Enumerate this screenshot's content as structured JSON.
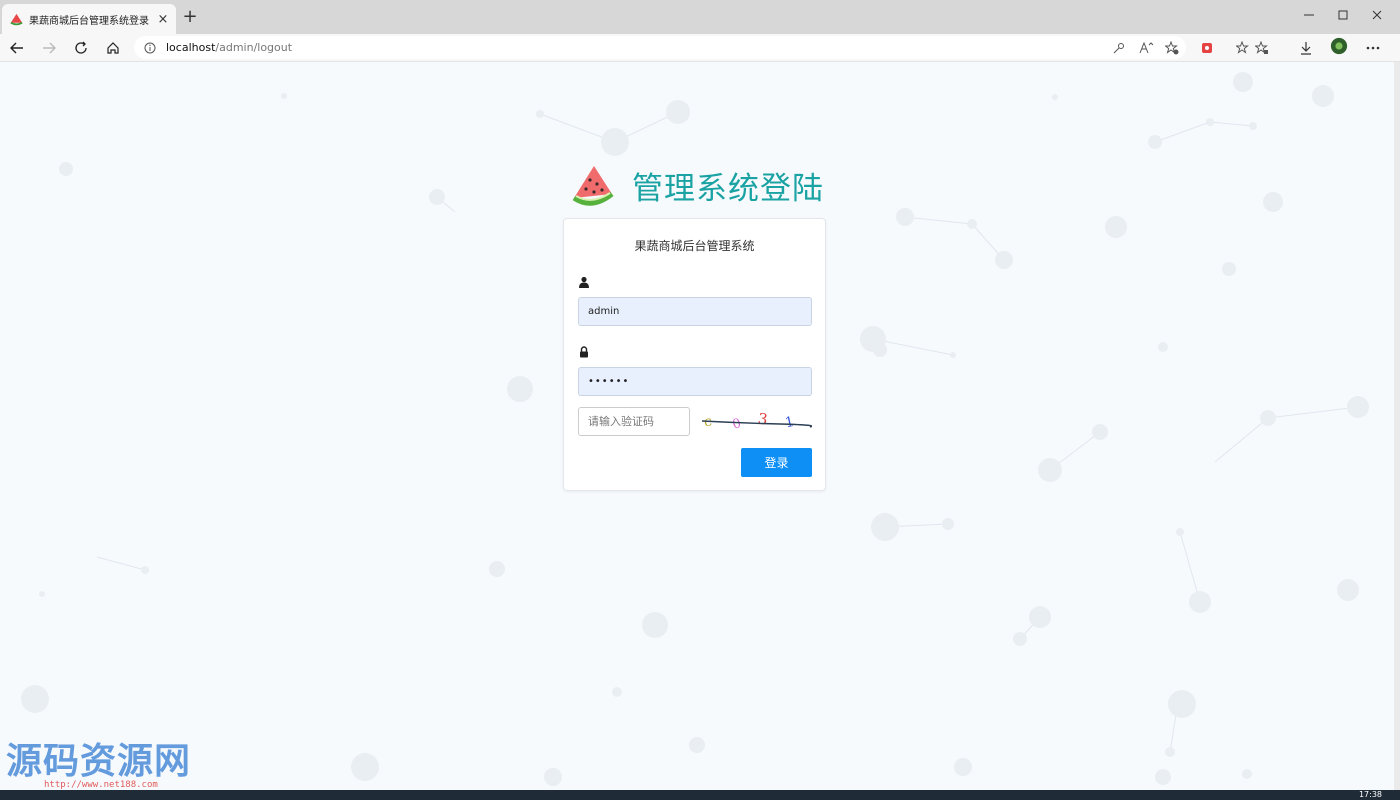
{
  "browser": {
    "tab_title": "果蔬商城后台管理系统登录",
    "tab_close": "×",
    "new_tab": "+",
    "address_host": "localhost",
    "address_path": "/admin/logout"
  },
  "brand": {
    "title": "管理系统登陆",
    "logo_icon": "watermelon-icon"
  },
  "login": {
    "subtitle": "果蔬商城后台管理系统",
    "user_icon": "user-icon",
    "username_value": "admin",
    "lock_icon": "lock-icon",
    "password_value": "••••••",
    "captcha_placeholder": "请输入验证码",
    "captcha_chars": [
      "c",
      "0",
      "3",
      "1"
    ],
    "login_button": "登录"
  },
  "watermark": {
    "text": "源码资源网",
    "url": "http://www.net188.com"
  },
  "taskbar": {
    "clock": "17:38"
  },
  "colors": {
    "brand_teal": "#1ba3a4",
    "button_blue": "#0d8ff6",
    "input_fill": "#e8f0fe"
  }
}
